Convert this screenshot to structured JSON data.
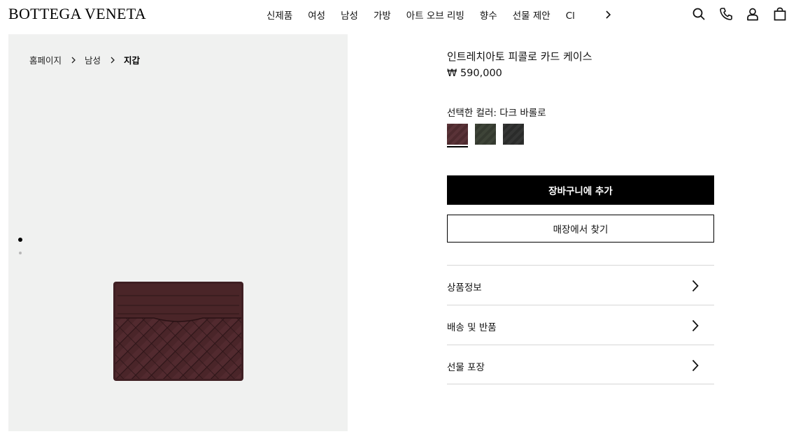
{
  "header": {
    "logo": "BOTTEGA VENETA",
    "nav": [
      "신제품",
      "여성",
      "남성",
      "가방",
      "아트 오브 리빙",
      "향수",
      "선물 제안",
      "Cl"
    ],
    "icons": [
      "search-icon",
      "phone-icon",
      "account-icon",
      "shopping-bag-icon",
      "chevron-right-icon"
    ]
  },
  "breadcrumb": [
    "홈페이지",
    "남성",
    "지갑"
  ],
  "carousel": {
    "slides": 2,
    "active_slide": 1
  },
  "product": {
    "title": "인트레치아토 피콜로 카드 케이스",
    "price": "₩ 590,000",
    "color_label": "선택한 컬러: 다크 바롤로",
    "swatches": [
      {
        "color": "#4d2a2e",
        "selected": true
      },
      {
        "color": "#34392f",
        "selected": false
      },
      {
        "color": "#2a2b2a",
        "selected": false
      }
    ],
    "add_to_cart": "장바구니에 추가",
    "find_in_store": "매장에서 찾기"
  },
  "accordion": [
    "상품정보",
    "배송 및 반품",
    "선물 포장"
  ],
  "colors": {
    "image_background": "#f0f1f0",
    "primary_button": "#000000",
    "product_leather": "#4a2529"
  }
}
